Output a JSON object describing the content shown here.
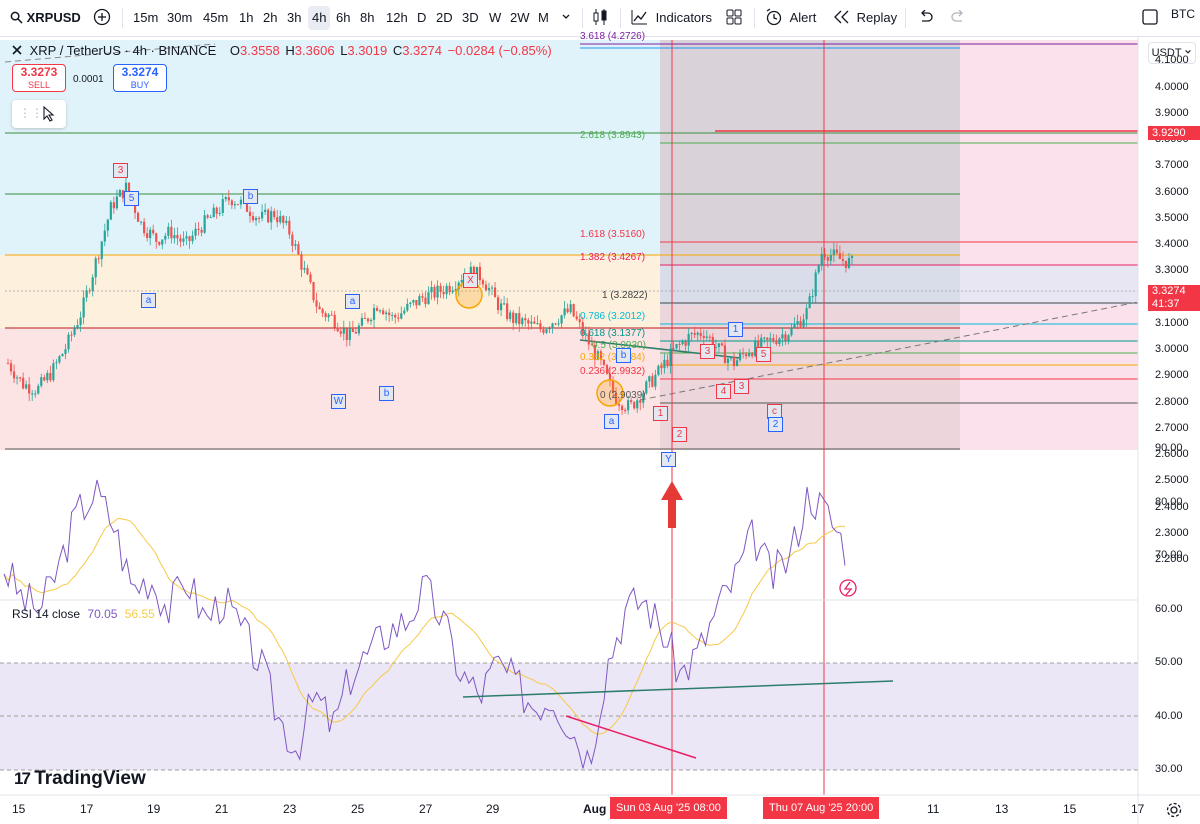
{
  "toolbar": {
    "symbol": "XRPUSD",
    "intervals": [
      "15m",
      "30m",
      "45m",
      "1h",
      "2h",
      "3h",
      "4h",
      "6h",
      "8h",
      "12h",
      "D",
      "2D",
      "3D",
      "W",
      "2W",
      "M"
    ],
    "active_interval": "4h",
    "indicators_label": "Indicators",
    "alert_label": "Alert",
    "replay_label": "Replay",
    "compare_label": "BTC"
  },
  "legend": {
    "pair": "XRP / TetherUS · 4h · BINANCE",
    "open_label": "O",
    "open": "3.3558",
    "high_label": "H",
    "high": "3.3606",
    "low_label": "L",
    "low": "3.3019",
    "close_label": "C",
    "close": "3.3274",
    "change": "−0.0284 (−0.85%)"
  },
  "trade": {
    "sell_price": "3.3273",
    "sell_label": "SELL",
    "spread": "0.0001",
    "buy_price": "3.3274",
    "buy_label": "BUY"
  },
  "price_axis": {
    "currency": "USDT",
    "ticks": [
      "4.1000",
      "4.0000",
      "3.9000",
      "3.8000",
      "3.7000",
      "3.6000",
      "3.5000",
      "3.4000",
      "3.3000",
      "3.2000",
      "3.1000",
      "3.0000",
      "2.9000",
      "2.8000",
      "2.7000",
      "2.6000",
      "2.5000",
      "2.4000",
      "2.3000",
      "2.2000"
    ],
    "alert_level": "3.9290",
    "last_price": "3.3274",
    "countdown": "41:37"
  },
  "fib_labels": [
    "3.618 (4.2726)",
    "2.618 (3.8943)",
    "1.618 (3.5160)",
    "1.382 (3.4267)",
    "1 (3.2822)",
    "0.786 (3.2012)",
    "0.618 (3.1377)",
    "0.5 (3.0930)",
    "0.382 (3.0484)",
    "0.236 (2.9932)",
    "0 (2.9039)"
  ],
  "wave_labels": [
    "3",
    "5",
    "b",
    "a",
    "a",
    "W",
    "b",
    "X",
    "b",
    "a",
    "Y",
    "1",
    "2",
    "1",
    "3",
    "5",
    "4",
    "3",
    "c",
    "2"
  ],
  "rsi": {
    "title": "RSI 14 close",
    "value": "70.05",
    "ma_value": "56.55",
    "ticks": [
      "90.00",
      "80.00",
      "70.00",
      "60.00",
      "50.00",
      "40.00",
      "30.00"
    ]
  },
  "time_axis": {
    "labels": [
      "15",
      "17",
      "19",
      "21",
      "23",
      "25",
      "27",
      "29",
      "Aug",
      "11",
      "13",
      "15",
      "17"
    ],
    "marker1": "Sun 03 Aug '25   08:00",
    "marker2": "Thu 07 Aug '25   20:00"
  },
  "watermark": "TradingView",
  "colors": {
    "up": "#26a69a",
    "down": "#ef5350",
    "accent": "#2962ff",
    "alert": "#f23645"
  },
  "chart_data": {
    "type": "candlestick",
    "title": "XRP / TetherUS · 4h · BINANCE",
    "ylabel": "USDT",
    "ylim": [
      2.1,
      4.2
    ],
    "close_path": [
      2.95,
      2.87,
      2.85,
      2.92,
      3.02,
      3.15,
      3.35,
      3.55,
      3.62,
      3.48,
      3.42,
      3.45,
      3.4,
      3.47,
      3.52,
      3.58,
      3.55,
      3.5,
      3.52,
      3.45,
      3.3,
      3.15,
      3.12,
      3.05,
      3.1,
      3.18,
      3.12,
      3.16,
      3.2,
      3.22,
      3.25,
      3.3,
      3.28,
      3.18,
      3.12,
      3.1,
      3.08,
      3.12,
      3.15,
      3.05,
      2.95,
      2.82,
      2.78,
      2.85,
      2.92,
      3.0,
      3.05,
      3.07,
      3.0,
      2.95,
      3.0,
      3.02,
      3.05,
      3.08,
      3.15,
      3.38,
      3.35,
      3.33
    ],
    "rsi_range": [
      30,
      90
    ]
  }
}
